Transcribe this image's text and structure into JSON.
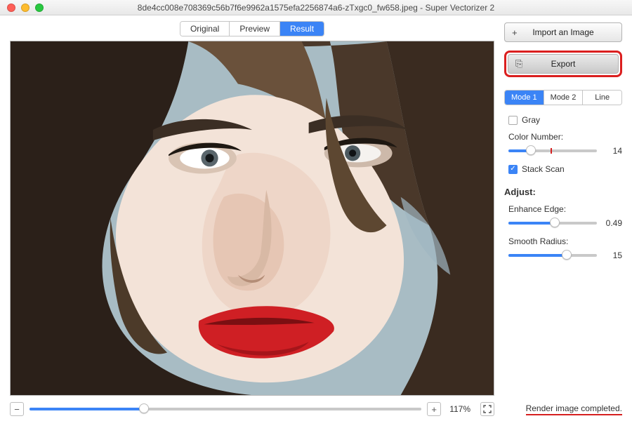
{
  "title": "8de4cc008e708369c56b7f6e9962a1575efa2256874a6-zTxgc0_fw658.jpeg - Super Vectorizer 2",
  "view_tabs": {
    "original": "Original",
    "preview": "Preview",
    "result": "Result",
    "active": "result"
  },
  "zoom": {
    "value_label": "117%",
    "minus": "−",
    "plus": "+"
  },
  "sidebar": {
    "import_label": "Import an Image",
    "export_label": "Export",
    "modes": {
      "m1": "Mode 1",
      "m2": "Mode 2",
      "line": "Line",
      "active": "m1"
    },
    "gray": {
      "label": "Gray",
      "checked": false
    },
    "color_number": {
      "label": "Color Number:",
      "value": 14
    },
    "stack_scan": {
      "label": "Stack Scan",
      "checked": true
    },
    "adjust_header": "Adjust:",
    "enhance_edge": {
      "label": "Enhance Edge:",
      "value": 0.49
    },
    "smooth_radius": {
      "label": "Smooth Radius:",
      "value": 15
    }
  },
  "status_text": "Render image completed.",
  "colors": {
    "accent": "#3b84f6",
    "highlight": "#db1f1f"
  }
}
